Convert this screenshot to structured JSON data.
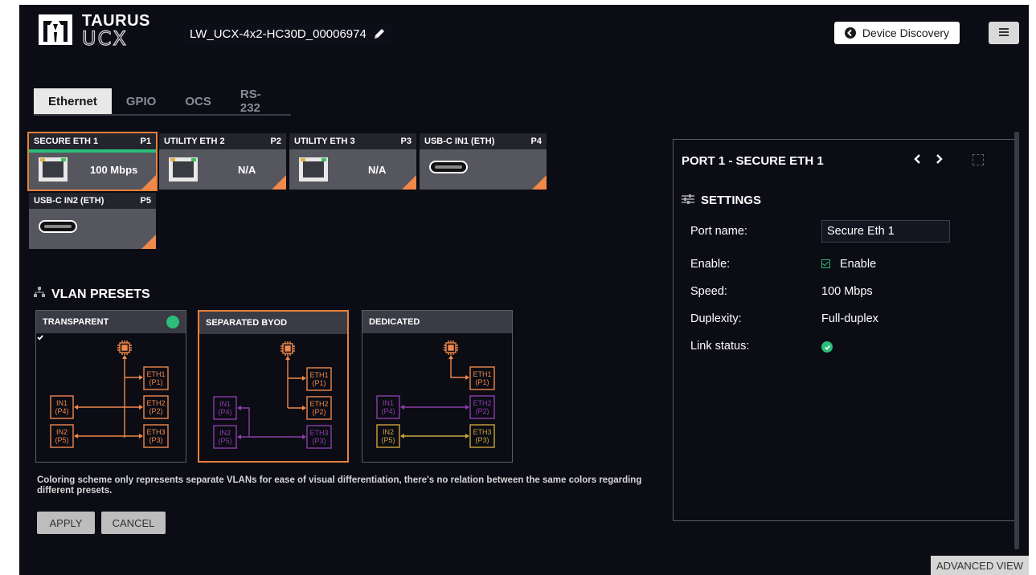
{
  "header": {
    "logo_top": "TAURUS",
    "logo_bottom": "UCX",
    "device_name": "LW_UCX-4x2-HC30D_00006974",
    "device_discovery_label": "Device Discovery",
    "menu_icon": "hamburger-icon"
  },
  "tabs": [
    {
      "label": "Ethernet",
      "active": true
    },
    {
      "label": "GPIO"
    },
    {
      "label": "OCS"
    },
    {
      "label": "RS-232"
    }
  ],
  "ports": [
    {
      "name": "SECURE ETH 1",
      "id": "P1",
      "value": "100 Mbps",
      "connector": "rj45",
      "selected": true
    },
    {
      "name": "UTILITY ETH 2",
      "id": "P2",
      "value": "N/A",
      "connector": "rj45"
    },
    {
      "name": "UTILITY ETH 3",
      "id": "P3",
      "value": "N/A",
      "connector": "rj45"
    },
    {
      "name": "USB-C IN1 (ETH)",
      "id": "P4",
      "value": "",
      "connector": "usb-c"
    },
    {
      "name": "USB-C IN2 (ETH)",
      "id": "P5",
      "value": "",
      "connector": "usb-c"
    }
  ],
  "vlan": {
    "title": "VLAN PRESETS",
    "presets": [
      {
        "name": "TRANSPARENT",
        "active": true
      },
      {
        "name": "SEPARATED BYOD",
        "selected": true
      },
      {
        "name": "DEDICATED"
      }
    ],
    "node_labels": {
      "eth1": [
        "ETH1",
        "(P1)"
      ],
      "eth2": [
        "ETH2",
        "(P2)"
      ],
      "eth3": [
        "ETH3",
        "(P3)"
      ],
      "in1": [
        "IN1",
        "(P4)"
      ],
      "in2": [
        "IN2",
        "(P5)"
      ]
    },
    "colors": {
      "orange": "#f0884a",
      "purple": "#8a3ea8",
      "gold": "#c9a53a"
    },
    "note": "Coloring scheme only represents separate VLANs for ease of visual differentiation, there's no relation between the same colors regarding different presets.",
    "apply_label": "APPLY",
    "cancel_label": "CANCEL"
  },
  "panel": {
    "title": "PORT 1 - SECURE ETH 1",
    "settings_title": "SETTINGS",
    "port_name_label": "Port name:",
    "port_name_value": "Secure Eth 1",
    "enable_label": "Enable:",
    "enable_value": "Enable",
    "speed_label": "Speed:",
    "speed_value": "100 Mbps",
    "duplexity_label": "Duplexity:",
    "duplexity_value": "Full-duplex",
    "link_status_label": "Link status:"
  },
  "advanced_view_label": "ADVANCED VIEW"
}
